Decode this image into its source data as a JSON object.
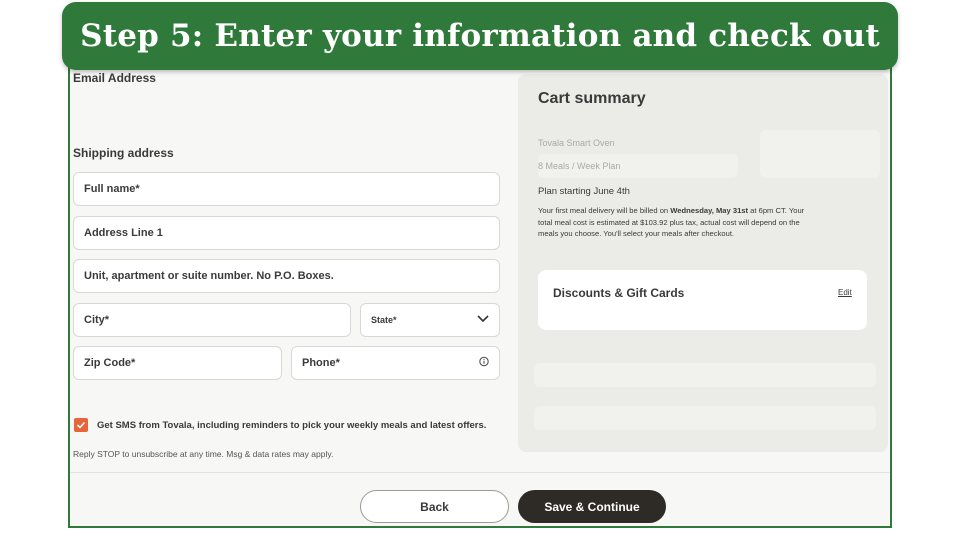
{
  "banner": {
    "title": "Step 5: Enter your information and check out"
  },
  "form": {
    "email_label": "Email Address",
    "shipping_label": "Shipping address",
    "full_name_placeholder": "Full name*",
    "address1_placeholder": "Address Line 1",
    "unit_placeholder": "Unit, apartment or suite number. No P.O. Boxes.",
    "city_placeholder": "City*",
    "state_value": "State*",
    "zip_placeholder": "Zip Code*",
    "phone_placeholder": "Phone*",
    "sms_checked": true,
    "sms_label": "Get SMS from Tovala, including reminders to pick your weekly meals and latest offers.",
    "reply_note": "Reply STOP to unsubscribe at any time. Msg & data rates may apply."
  },
  "cart": {
    "title": "Cart summary",
    "item_oven": "Tovala Smart Oven",
    "item_plan": "8 Meals / Week Plan",
    "plan_start": "Plan starting June 4th",
    "plan_desc_1": "Your first meal delivery will be billed on ",
    "plan_desc_date": "Wednesday, May 31st",
    "plan_desc_2": " at 6pm CT. Your total meal cost is estimated at $103.92 plus tax, actual cost will depend on the meals you choose. You'll select your meals after checkout.",
    "discounts_title": "Discounts & Gift Cards",
    "edit_label": "Edit"
  },
  "actions": {
    "back_label": "Back",
    "save_label": "Save & Continue"
  },
  "colors": {
    "banner": "#2f7a3a",
    "checkbox": "#e8643a",
    "primary_button": "#2e2a26"
  }
}
